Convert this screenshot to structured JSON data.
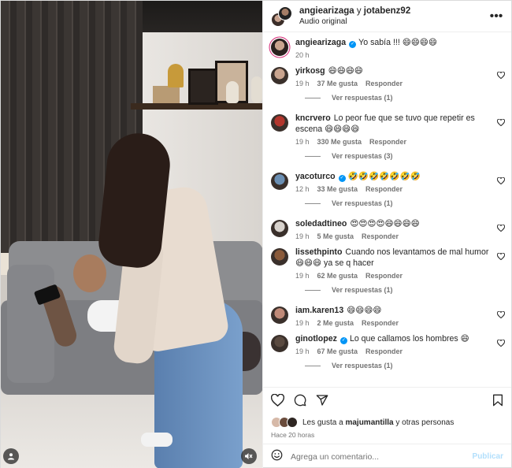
{
  "header": {
    "user1": "angiearizaga",
    "conjunction": "y",
    "user2": "jotabenz92",
    "audio": "Audio original",
    "more_icon": "more-horizontal-icon"
  },
  "caption": {
    "user": "angiearizaga",
    "text": "Yo sabía !!! 😄😄😄😄",
    "time": "20 h"
  },
  "comments": [
    {
      "user": "yirkosg",
      "verified": false,
      "text": "😄😄😄😄",
      "time": "19 h",
      "likes": "37 Me gusta",
      "reply": "Responder",
      "replies": "Ver respuestas (1)",
      "avatar_color": "#c9a48e"
    },
    {
      "user": "kncrvero",
      "verified": false,
      "text": "Lo peor fue que se tuvo que repetir es escena 😄😄😄😄",
      "time": "19 h",
      "likes": "330 Me gusta",
      "reply": "Responder",
      "replies": "Ver respuestas (3)",
      "avatar_color": "#b2362d"
    },
    {
      "user": "yacoturco",
      "verified": true,
      "text": "🤣🤣🤣🤣🤣🤣🤣",
      "time": "12 h",
      "likes": "33 Me gusta",
      "reply": "Responder",
      "replies": "Ver respuestas (1)",
      "avatar_color": "#6b8fb3"
    },
    {
      "user": "soledadtineo",
      "verified": false,
      "text": "😍😍😍😍😄😄😄😄",
      "time": "19 h",
      "likes": "5 Me gusta",
      "reply": "Responder",
      "replies": "",
      "avatar_color": "#d8d2cc"
    },
    {
      "user": "lissethpinto",
      "verified": false,
      "text": "Cuando nos levantamos de mal humor 😄😄😄 ya se q hacer",
      "time": "19 h",
      "likes": "62 Me gusta",
      "reply": "Responder",
      "replies": "Ver respuestas (1)",
      "avatar_color": "#8a5a3a"
    },
    {
      "user": "iam.karen13",
      "verified": false,
      "text": "😄😄😄😄",
      "time": "19 h",
      "likes": "2 Me gusta",
      "reply": "Responder",
      "replies": "",
      "avatar_color": "#c08a78"
    },
    {
      "user": "ginotlopez",
      "verified": true,
      "text": "Lo que callamos los hombres 😄",
      "time": "19 h",
      "likes": "67 Me gusta",
      "reply": "Responder",
      "replies": "Ver respuestas (1)",
      "avatar_color": "#5a4a40"
    }
  ],
  "actions": {
    "like_icon": "heart-icon",
    "comment_icon": "comment-icon",
    "share_icon": "send-icon",
    "save_icon": "bookmark-icon"
  },
  "likes": {
    "prefix": "Les gusta a",
    "user": "majumantilla",
    "suffix": "y otras personas"
  },
  "post_time": "Hace 20 horas",
  "add_comment": {
    "placeholder": "Agrega un comentario...",
    "publish": "Publicar"
  },
  "colors": {
    "verified": "#0095f6",
    "secondary_text": "#737373",
    "publish_disabled": "#b2dffc"
  }
}
